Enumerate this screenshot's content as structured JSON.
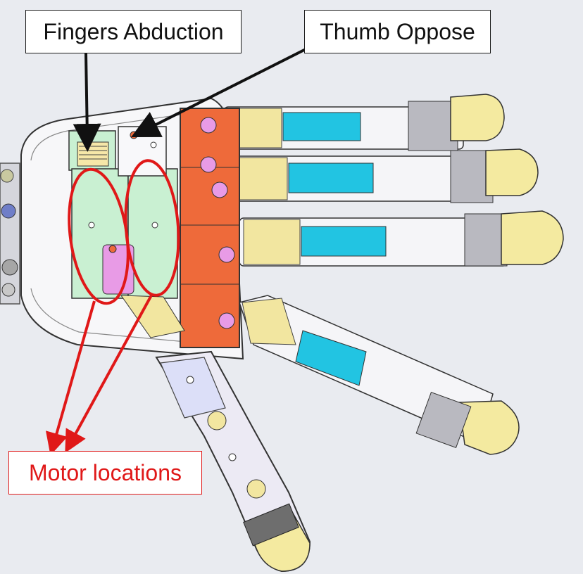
{
  "labels": {
    "fingers_abduction": "Fingers Abduction",
    "thumb_oppose": "Thumb Oppose",
    "motor_locations": "Motor locations"
  },
  "colors": {
    "background": "#e9ebf0",
    "arrow_black": "#111111",
    "annotation_red": "#e01818",
    "palm_orange": "#ee6a3a",
    "segment_cyan": "#22c4e2",
    "segment_yellow": "#f2e6a0",
    "fingertip": "#f4eaa0",
    "motor_green": "#c9f0d2",
    "screw_pink": "#e89be6",
    "palm_frame": "#f7f7f9"
  }
}
